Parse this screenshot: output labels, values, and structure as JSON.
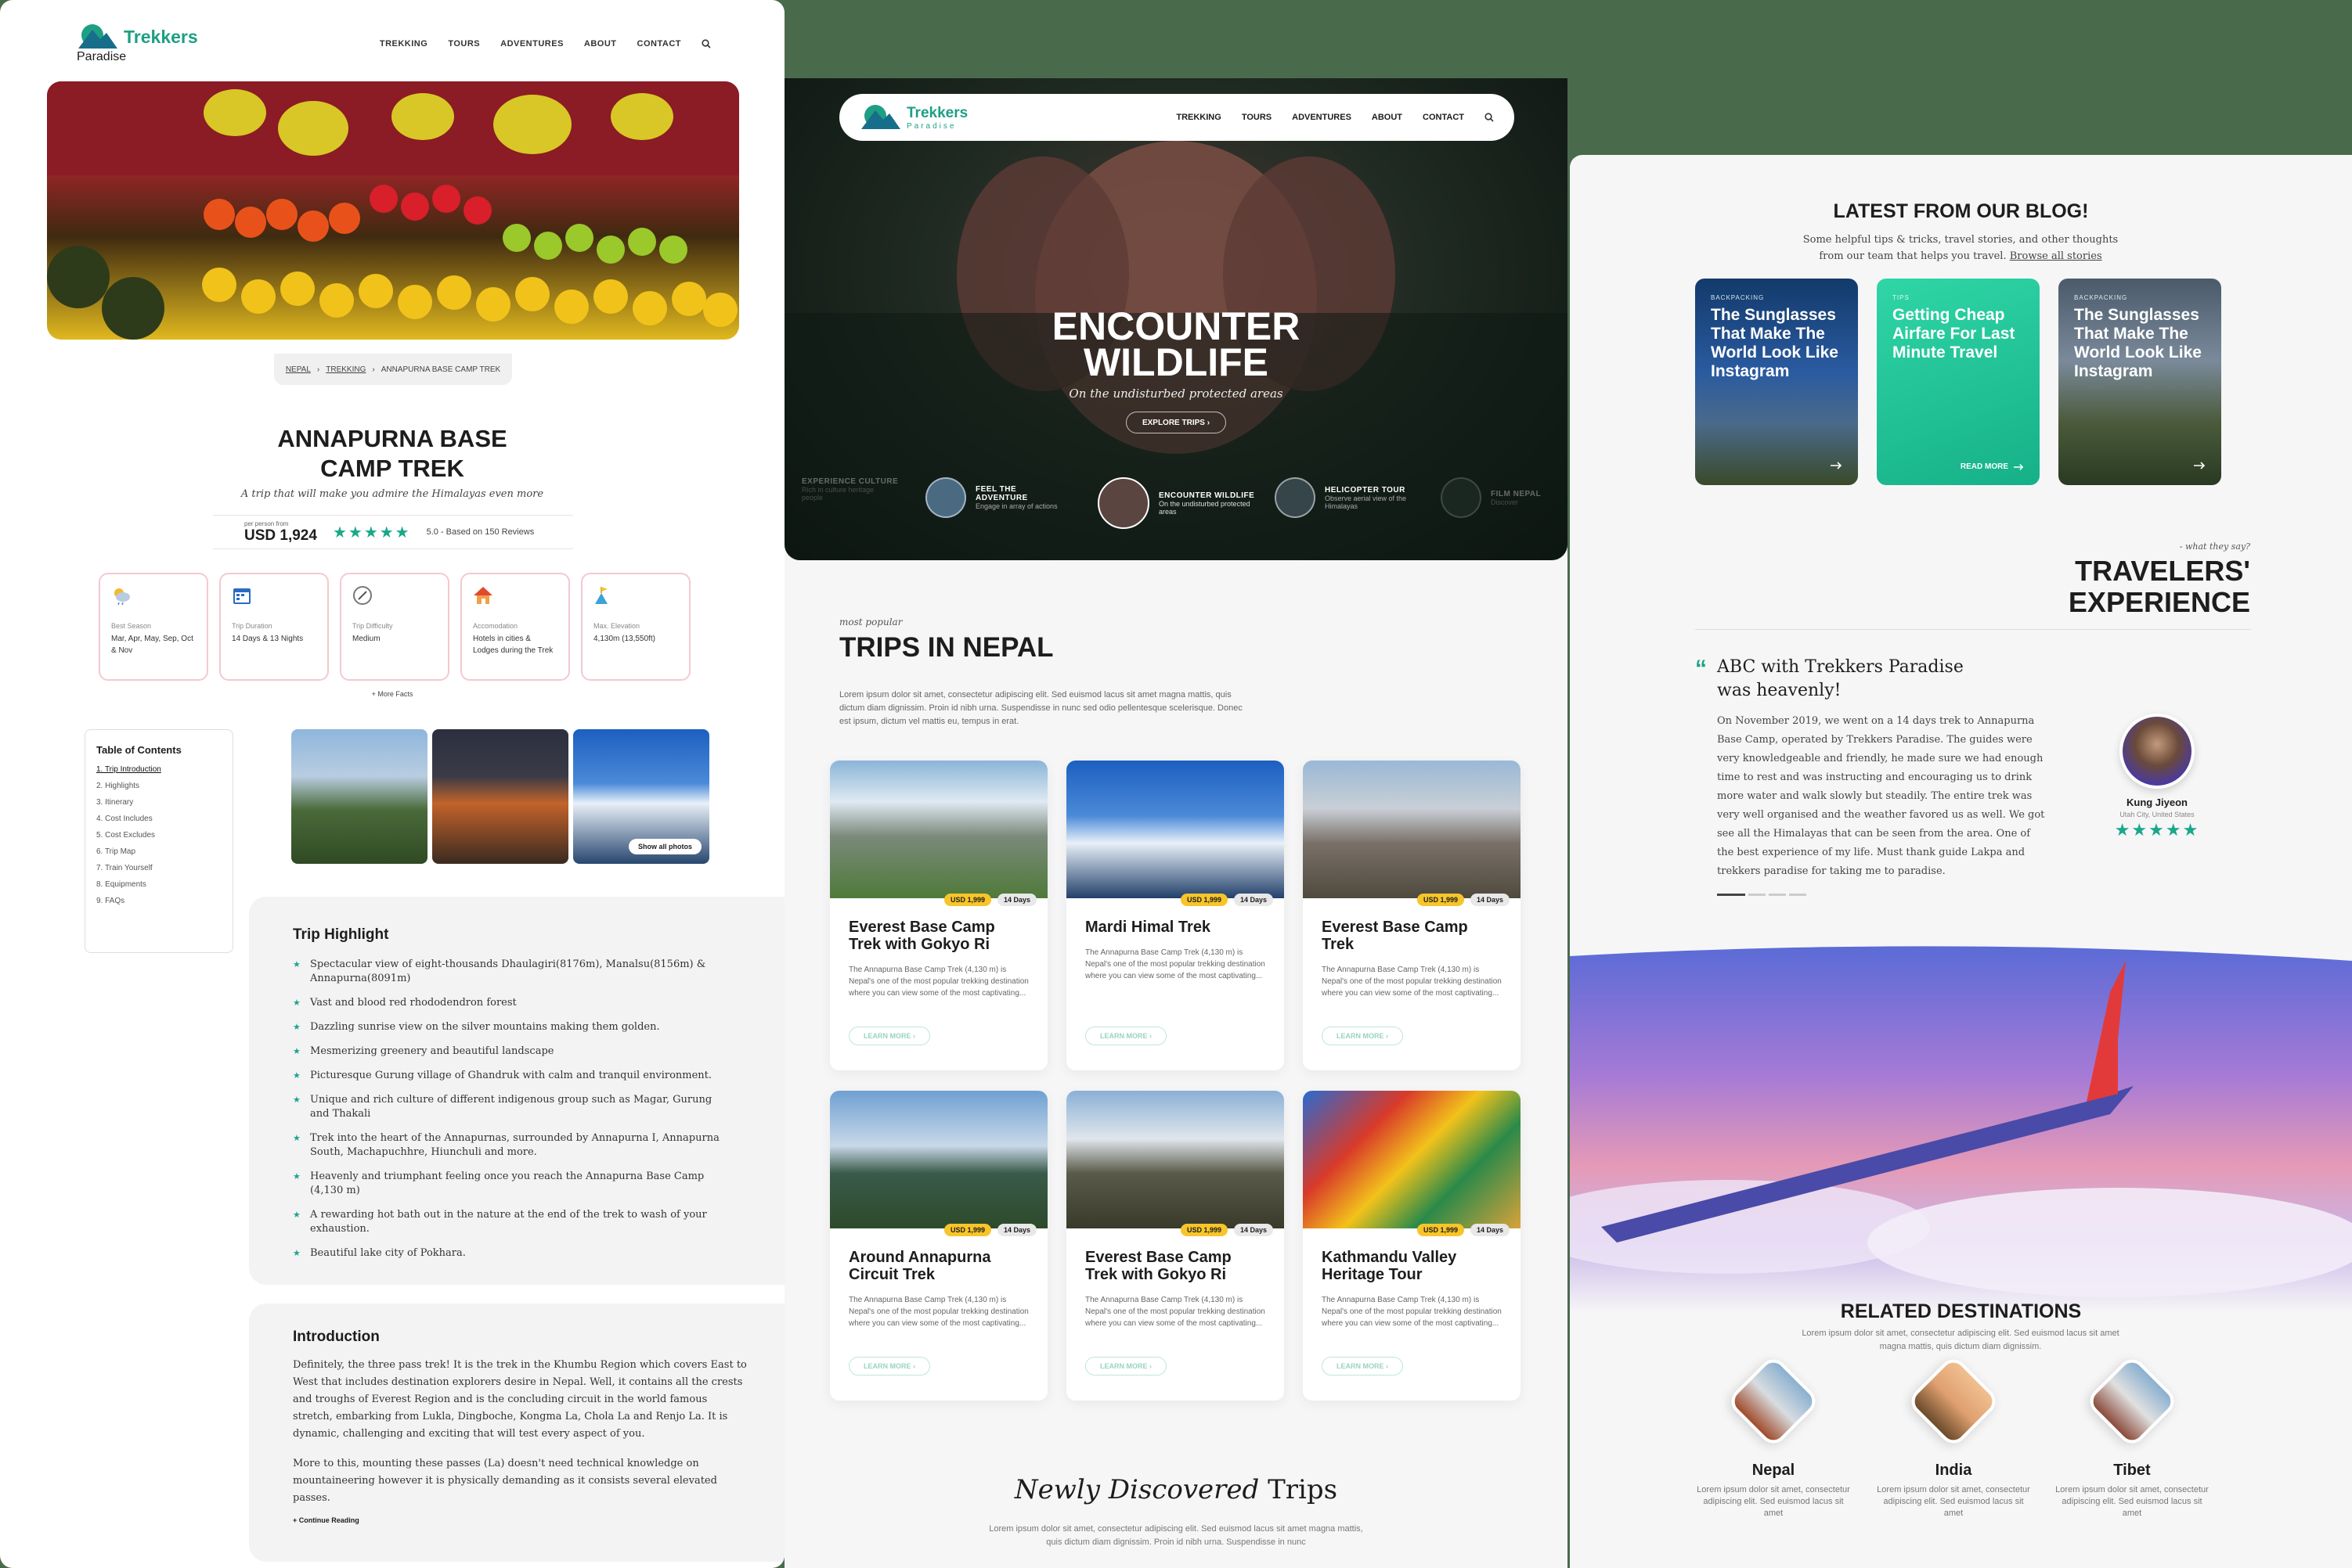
{
  "brand": {
    "name": "Trekkers",
    "sub": "Paradise",
    "accent": "#1e9f84",
    "star": "#18a88a"
  },
  "nav": {
    "items": [
      "TREKKING",
      "TOURS",
      "ADVENTURES",
      "ABOUT",
      "CONTACT"
    ],
    "icon": "search-icon"
  },
  "p1": {
    "breadcrumb": [
      "NEPAL",
      "TREKKING",
      "ANNAPURNA BASE CAMP TREK"
    ],
    "title_l1": "ANNAPURNA BASE",
    "title_l2": "CAMP TREK",
    "subtitle": "A trip that will make you admire the Himalayas even more",
    "price_label": "per person from",
    "price": "USD 1,924",
    "rating": "5.0 - Based on 150 Reviews",
    "stars": 5,
    "facts": [
      {
        "icon": "weather-icon",
        "label": "Best Season",
        "value": "Mar, Apr, May, Sep, Oct & Nov"
      },
      {
        "icon": "calendar-icon",
        "label": "Trip Duration",
        "value": "14 Days & 13 Nights"
      },
      {
        "icon": "compass-icon",
        "label": "Trip Difficulty",
        "value": "Medium"
      },
      {
        "icon": "house-icon",
        "label": "Accomodation",
        "value": "Hotels in cities & Lodges during the Trek"
      },
      {
        "icon": "elevation-icon",
        "label": "Max. Elevation",
        "value": "4,130m (13,550ft)"
      }
    ],
    "more_facts": "+ More Facts",
    "toc": {
      "title": "Table of Contents",
      "items": [
        "1. Trip Introduction",
        "2. Highlights",
        "3. Itinerary",
        "4. Cost Includes",
        "5. Cost Excludes",
        "6. Trip Map",
        "7. Train Yourself",
        "8. Equipments",
        "9. FAQs"
      ]
    },
    "show_photos": "Show all photos",
    "highlight": {
      "title": "Trip Highlight",
      "items": [
        "Spectacular view of eight-thousands Dhaulagiri(8176m), Manalsu(8156m) & Annapurna(8091m)",
        "Vast and blood red rhododendron forest",
        "Dazzling sunrise view on the silver mountains making them golden.",
        "Mesmerizing greenery and beautiful landscape",
        "Picturesque Gurung village of Ghandruk with calm and tranquil environment.",
        "Unique and rich culture of different indigenous group such as Magar, Gurung and Thakali",
        "Trek into the heart of the Annapurnas, surrounded by Annapurna I, Annapurna South,     Machapuchhre, Hiunchuli and more.",
        "Heavenly and triumphant feeling once you reach the Annapurna Base Camp (4,130 m)",
        "A rewarding hot bath out in the nature at the end of the trek to wash of your exhaustion.",
        "Beautiful lake city of Pokhara."
      ]
    },
    "intro": {
      "title": "Introduction",
      "p1": "Definitely, the  three pass trek! It is the trek  in the Khumbu Region which covers East to West that includes destination explorers desire in Nepal. Well, it contains all the crests and troughs of Everest Region and is the concluding circuit in the world famous stretch, embarking from Lukla, Dingboche, Kongma La, Chola La and Renjo La. It is dynamic, challenging and exciting that will test every aspect of you.",
      "p2": "More to this, mounting these passes (La) doesn't need technical knowledge on mountaineering however it is physically demanding as it consists several elevated passes.",
      "link": "+ Continue Reading"
    }
  },
  "p2": {
    "hero_title_l1": "ENCOUNTER",
    "hero_title_l2": "WILDLIFE",
    "hero_sub": "On the undisturbed protected areas",
    "hero_btn": "EXPLORE TRIPS ›",
    "features": [
      {
        "title": "EXPERIENCE CULTURE",
        "desc": "Rich in culture heritage people"
      },
      {
        "title": "FEEL THE ADVENTURE",
        "desc": "Engage in array of actions"
      },
      {
        "title": "ENCOUNTER WILDLIFE",
        "desc": "On the undisturbed protected areas"
      },
      {
        "title": "HELICOPTER TOUR",
        "desc": "Observe aerial view of the Himalayas"
      },
      {
        "title": "FILM NEPAL",
        "desc": "Discover"
      }
    ],
    "eyebrow": "most popular",
    "section_title": "TRIPS IN NEPAL",
    "section_desc": "Lorem ipsum dolor sit amet, consectetur adipiscing elit. Sed euismod lacus sit amet magna mattis, quis dictum diam dignissim. Proin id nibh urna. Suspendisse in nunc sed odio pellentesque scelerisque. Donec est ipsum, dictum vel mattis eu, tempus in erat.",
    "cards": [
      {
        "title": "Everest Base Camp Trek with Gokyo Ri",
        "price": "USD 1,999",
        "days": "14 Days",
        "desc": "The Annapurna Base Camp Trek (4,130 m) is Nepal's one of the most popular trekking destination where you can view some of the most captivating...",
        "btn": "LEARN MORE ›"
      },
      {
        "title": "Mardi Himal Trek",
        "price": "USD 1,999",
        "days": "14 Days",
        "desc": "The Annapurna Base Camp Trek (4,130 m) is Nepal's one of the most popular trekking destination where you can view some of the most captivating...",
        "btn": "LEARN MORE ›"
      },
      {
        "title": "Everest Base Camp Trek",
        "price": "USD 1,999",
        "days": "14 Days",
        "desc": "The Annapurna Base Camp Trek (4,130 m) is Nepal's one of the most popular trekking destination where you can view some of the most captivating...",
        "btn": "LEARN MORE ›"
      },
      {
        "title": "Around Annapurna Circuit Trek",
        "price": "USD 1,999",
        "days": "14 Days",
        "desc": "The Annapurna Base Camp Trek (4,130 m) is Nepal's one of the most popular trekking destination where you can view some of the most captivating...",
        "btn": "LEARN MORE ›"
      },
      {
        "title": "Everest Base Camp Trek with Gokyo Ri",
        "price": "USD 1,999",
        "days": "14 Days",
        "desc": "The Annapurna Base Camp Trek (4,130 m) is Nepal's one of the most popular trekking destination where you can view some of the most captivating...",
        "btn": "LEARN MORE ›"
      },
      {
        "title": "Kathmandu Valley Heritage Tour",
        "price": "USD 1,999",
        "days": "14 Days",
        "desc": "The Annapurna Base Camp Trek (4,130 m) is Nepal's one of the most popular trekking destination where you can view some of the most captivating...",
        "btn": "LEARN MORE ›"
      }
    ],
    "new_title_a": "Newly Discovered",
    "new_title_b": "Trips",
    "new_desc": "Lorem ipsum dolor sit amet, consectetur adipiscing elit. Sed euismod lacus sit amet magna mattis, quis dictum diam dignissim. Proin id nibh urna. Suspendisse in nunc"
  },
  "p3": {
    "blog_title": "LATEST FROM OUR BLOG!",
    "blog_desc": "Some helpful tips & tricks, travel stories, and other thoughts from our team that helps you travel.",
    "blog_link": "Browse all stories",
    "blog": [
      {
        "cat": "BACKPACKING",
        "title": "The Sunglasses That Make The World Look Like Instagram",
        "more": ""
      },
      {
        "cat": "TIPS",
        "title": "Getting Cheap Airfare For Last Minute Travel",
        "more": "READ MORE"
      },
      {
        "cat": "BACKPACKING",
        "title": "The Sunglasses That Make The World Look Like Instagram",
        "more": ""
      }
    ],
    "testi_eyebrow": "- what they say?",
    "testi_title_l1": "TRAVELERS'",
    "testi_title_l2": "EXPERIENCE",
    "quote": "ABC with Trekkers Paradise was heavenly!",
    "review": "On November 2019, we went on a 14 days trek to Annapurna Base Camp, operated by Trekkers Paradise. The guides were very knowledgeable and friendly, he made sure we had enough time to rest and was instructing and encouraging us to drink more water and walk slowly but steadily. The entire trek was very well organised and the weather favored us as well. We got see all the Himalayas that can be seen from the area. One of the best experience of my life. Must thank guide Lakpa and trekkers paradise for taking me to paradise.",
    "reviewer": "Kung Jiyeon",
    "reviewer_loc": "Utah City, United States",
    "dest_title": "RELATED DESTINATIONS",
    "dest_desc": "Lorem ipsum dolor sit amet, consectetur adipiscing elit. Sed euismod lacus sit amet magna mattis, quis dictum diam dignissim.",
    "dests": [
      {
        "name": "Nepal",
        "desc": "Lorem ipsum dolor sit amet, consectetur adipiscing elit. Sed euismod lacus sit amet"
      },
      {
        "name": "India",
        "desc": "Lorem ipsum dolor sit amet, consectetur adipiscing elit. Sed euismod lacus sit amet"
      },
      {
        "name": "Tibet",
        "desc": "Lorem ipsum dolor sit amet, consectetur adipiscing elit. Sed euismod lacus sit amet"
      }
    ]
  }
}
